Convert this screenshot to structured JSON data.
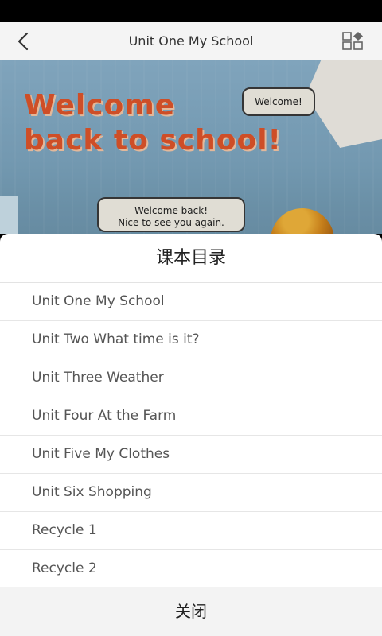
{
  "app_bar": {
    "title": "Unit One My School",
    "back_icon": "back-arrow-icon",
    "grid_icon": "grid-icon"
  },
  "page_image": {
    "headline_line1": "Welcome",
    "headline_line2": "back to school!",
    "bubble_1": "Welcome!",
    "bubble_2_line1": "Welcome back!",
    "bubble_2_line2": "Nice to see you again."
  },
  "toc_sheet": {
    "title": "课本目录",
    "items": [
      "Unit One My School",
      "Unit Two What time is it?",
      "Unit Three Weather",
      "Unit Four At the Farm",
      "Unit Five My Clothes",
      "Unit Six Shopping",
      "Recycle 1",
      "Recycle 2"
    ],
    "close_label": "关闭"
  },
  "colors": {
    "status_bar": "#000000",
    "app_bar": "#f4f4f4",
    "headline": "#e0552b",
    "sheet_bg": "#ffffff",
    "close_bg": "#f3f3f3"
  }
}
